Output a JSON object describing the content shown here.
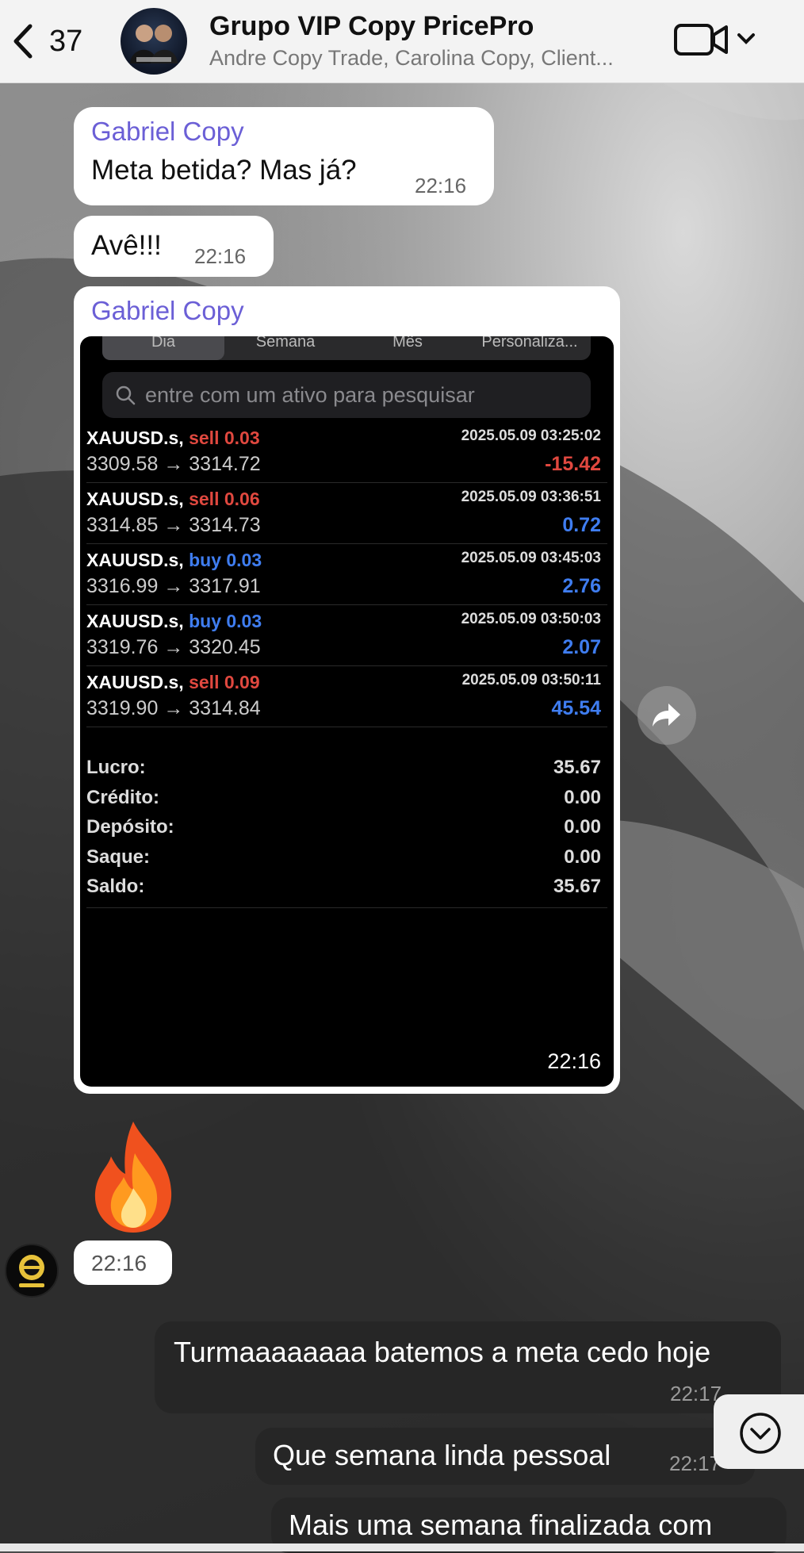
{
  "header": {
    "back_count": "37",
    "title": "Grupo VIP Copy PricePro",
    "subtitle": "Andre Copy Trade, Carolina Copy, Client..."
  },
  "messages": {
    "m1": {
      "sender": "Gabriel Copy",
      "text": "Meta betida? Mas já?",
      "time": "22:16"
    },
    "m2": {
      "text": "Avê!!!",
      "time": "22:16"
    },
    "m3": {
      "sender": "Gabriel Copy",
      "time": "22:16"
    },
    "m4": {
      "emoji": "🔥",
      "time": "22:16"
    },
    "m5": {
      "text": "Turmaaaaaaaa batemos a meta cedo hoje",
      "time": "22:17"
    },
    "m6": {
      "text": "Que semana linda pessoal",
      "time": "22:17"
    },
    "m7": {
      "text": "Mais uma semana finalizada com"
    }
  },
  "screenshot": {
    "tabs": [
      "Dia",
      "Semana",
      "Mês",
      "Personaliza..."
    ],
    "active_tab": "Dia",
    "search_placeholder": "entre com um ativo para pesquisar",
    "trades": [
      {
        "symbol": "XAUUSD.s,",
        "action": "sell 0.03",
        "side": "sell",
        "datetime": "2025.05.09 03:25:02",
        "prices": "3309.58 → 3314.72",
        "profit": "-15.42"
      },
      {
        "symbol": "XAUUSD.s,",
        "action": "sell 0.06",
        "side": "sell",
        "datetime": "2025.05.09 03:36:51",
        "prices": "3314.85 → 3314.73",
        "profit": "0.72"
      },
      {
        "symbol": "XAUUSD.s,",
        "action": "buy 0.03",
        "side": "buy",
        "datetime": "2025.05.09 03:45:03",
        "prices": "3316.99 → 3317.91",
        "profit": "2.76"
      },
      {
        "symbol": "XAUUSD.s,",
        "action": "buy 0.03",
        "side": "buy",
        "datetime": "2025.05.09 03:50:03",
        "prices": "3319.76 → 3320.45",
        "profit": "2.07"
      },
      {
        "symbol": "XAUUSD.s,",
        "action": "sell 0.09",
        "side": "sell",
        "datetime": "2025.05.09 03:50:11",
        "prices": "3319.90 → 3314.84",
        "profit": "45.54"
      }
    ],
    "summary": [
      {
        "label": "Lucro:",
        "value": "35.67"
      },
      {
        "label": "Crédito:",
        "value": "0.00"
      },
      {
        "label": "Depósito:",
        "value": "0.00"
      },
      {
        "label": "Saque:",
        "value": "0.00"
      },
      {
        "label": "Saldo:",
        "value": "35.67"
      }
    ]
  },
  "colors": {
    "sender": "#6b5fd6",
    "sell": "#e0483f",
    "buy": "#3f7df0",
    "loss": "#e0483f"
  }
}
